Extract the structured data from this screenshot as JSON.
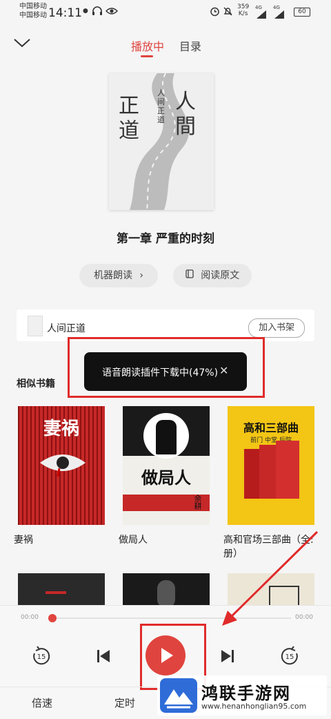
{
  "status_bar": {
    "carrier_1": "中国移动",
    "carrier_2": "中国移动",
    "time": "14:11",
    "net_speed_value": "359",
    "net_speed_unit": "K/s",
    "signal_1": "4G",
    "signal_2": "4G",
    "battery": "60",
    "icons": [
      "notification-dot-icon",
      "headphones-icon",
      "eye-icon",
      "alarm-icon",
      "mute-icon",
      "signal-icon",
      "battery-icon"
    ]
  },
  "header": {
    "tab_playing": "播放中",
    "tab_catalog": "目录"
  },
  "now_playing": {
    "cover_title": "人間",
    "cover_subtitle": "正道",
    "cover_vertical_title": "人间正道",
    "chapter_title": "第一章 严重的时刻"
  },
  "actions": {
    "tts_label": "机器朗读",
    "read_original_label": "阅读原文"
  },
  "book": {
    "name": "人间正道",
    "add_shelf": "加入书架"
  },
  "toast": {
    "text": "语音朗读插件下载中(47%)"
  },
  "similar": {
    "heading": "相似书籍",
    "books": [
      {
        "title": "妻祸",
        "cover_text": "妻祸"
      },
      {
        "title": "做局人",
        "cover_text": "做局人",
        "cover_author": "余耕"
      },
      {
        "title": "高和官场三部曲（全:",
        "title_line2": "册）",
        "cover_text": "高和三部曲",
        "cover_sub": "前门  中堂  后院"
      }
    ]
  },
  "player": {
    "time_elapsed": "00:00",
    "time_total": "00:00",
    "progress": 0,
    "rewind_seconds": "15",
    "forward_seconds": "15",
    "speed_label": "倍速",
    "timer_label": "定时"
  },
  "watermark": {
    "title": "鸿联手游网",
    "url": "www.henanhonglian95.com"
  },
  "colors": {
    "accent": "#e0443e",
    "annotation_red": "#e02b2b"
  }
}
